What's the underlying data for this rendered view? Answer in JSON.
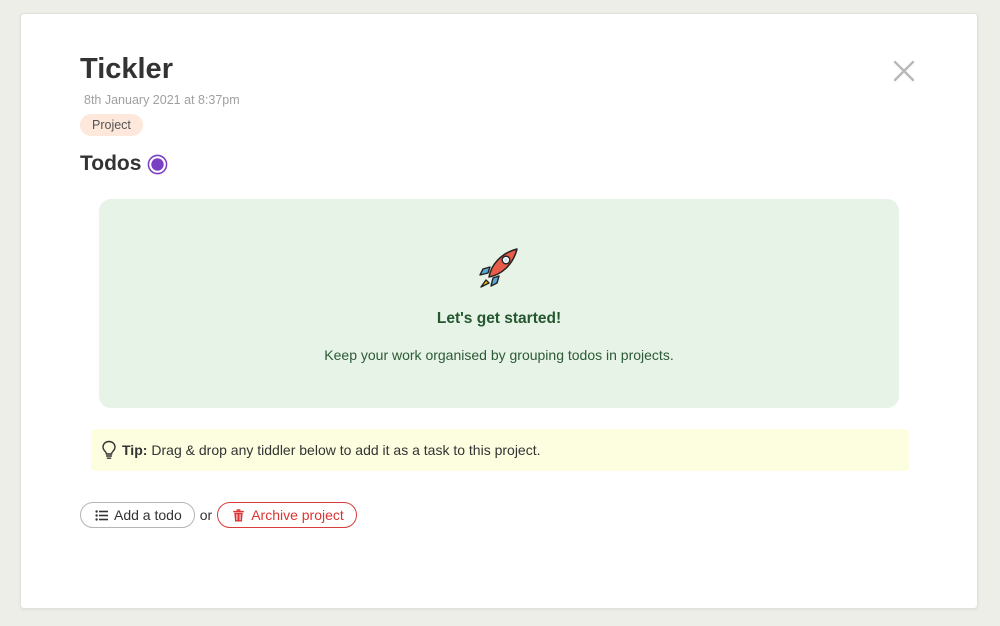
{
  "header": {
    "title": "Tickler",
    "subtitle": "8th January 2021 at 8:37pm",
    "tag": "Project"
  },
  "section": {
    "heading": "Todos",
    "status_color": "#7b3fc4"
  },
  "empty_state": {
    "icon": "rocket-icon",
    "title": "Let's get started!",
    "text": "Keep your work organised by grouping todos in projects."
  },
  "tip": {
    "icon": "lightbulb-icon",
    "label": "Tip:",
    "text": "Drag & drop any tiddler below to add it as a task to this project."
  },
  "actions": {
    "add_label": "Add a todo",
    "or_label": "or",
    "archive_label": "Archive project"
  },
  "colors": {
    "empty_bg": "#e6f3e6",
    "tip_bg": "#fdfde0",
    "tag_bg": "#fde8db",
    "danger": "#d33333"
  }
}
